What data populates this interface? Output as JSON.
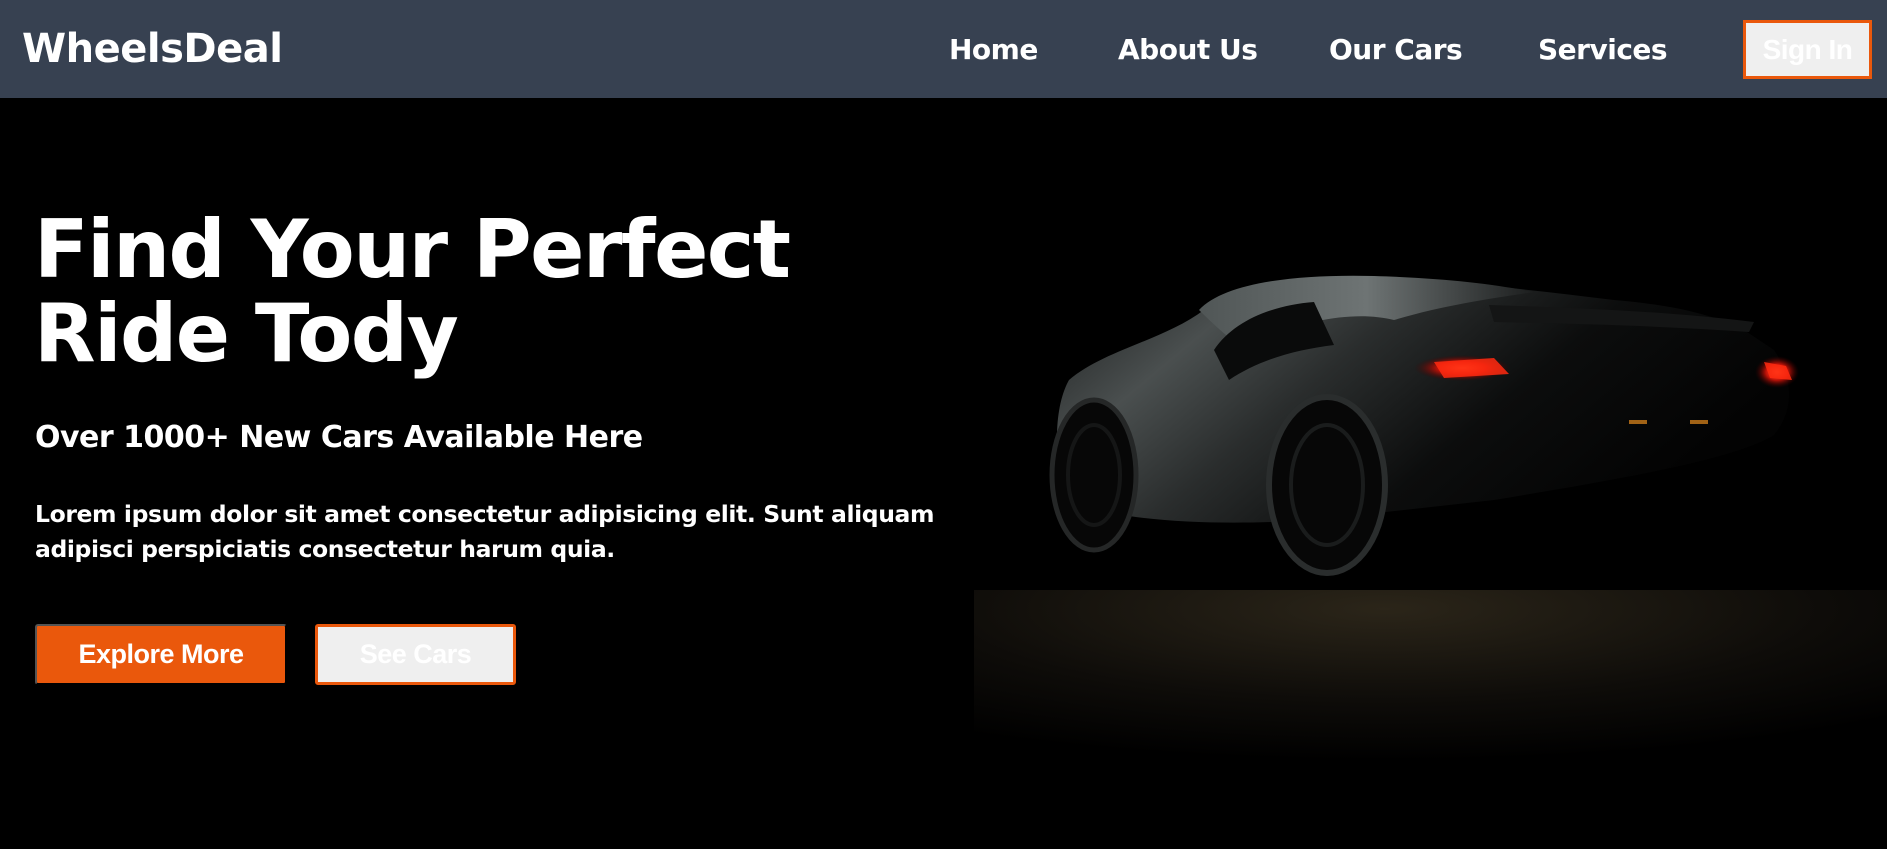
{
  "navbar": {
    "logo": "WheelsDeal",
    "items": [
      {
        "label": "Home"
      },
      {
        "label": "About Us"
      },
      {
        "label": "Our Cars"
      },
      {
        "label": "Services"
      }
    ],
    "signin_label": "Sign In"
  },
  "hero": {
    "title": "Find Your Perfect Ride Tody",
    "subtitle": "Over 1000+ New Cars Available Here",
    "description": "Lorem ipsum dolor sit amet consectetur adipisicing elit. Sunt aliquam adipisci perspiciatis consectetur harum quia.",
    "primary_button": "Explore More",
    "secondary_button": "See Cars"
  },
  "colors": {
    "navbar_bg": "#374151",
    "accent": "#ea580c",
    "hero_bg": "#000000",
    "text": "#ffffff",
    "taillight": "#ff2a10"
  },
  "images": {
    "hero_image": "dark-sports-car-rear-view"
  }
}
